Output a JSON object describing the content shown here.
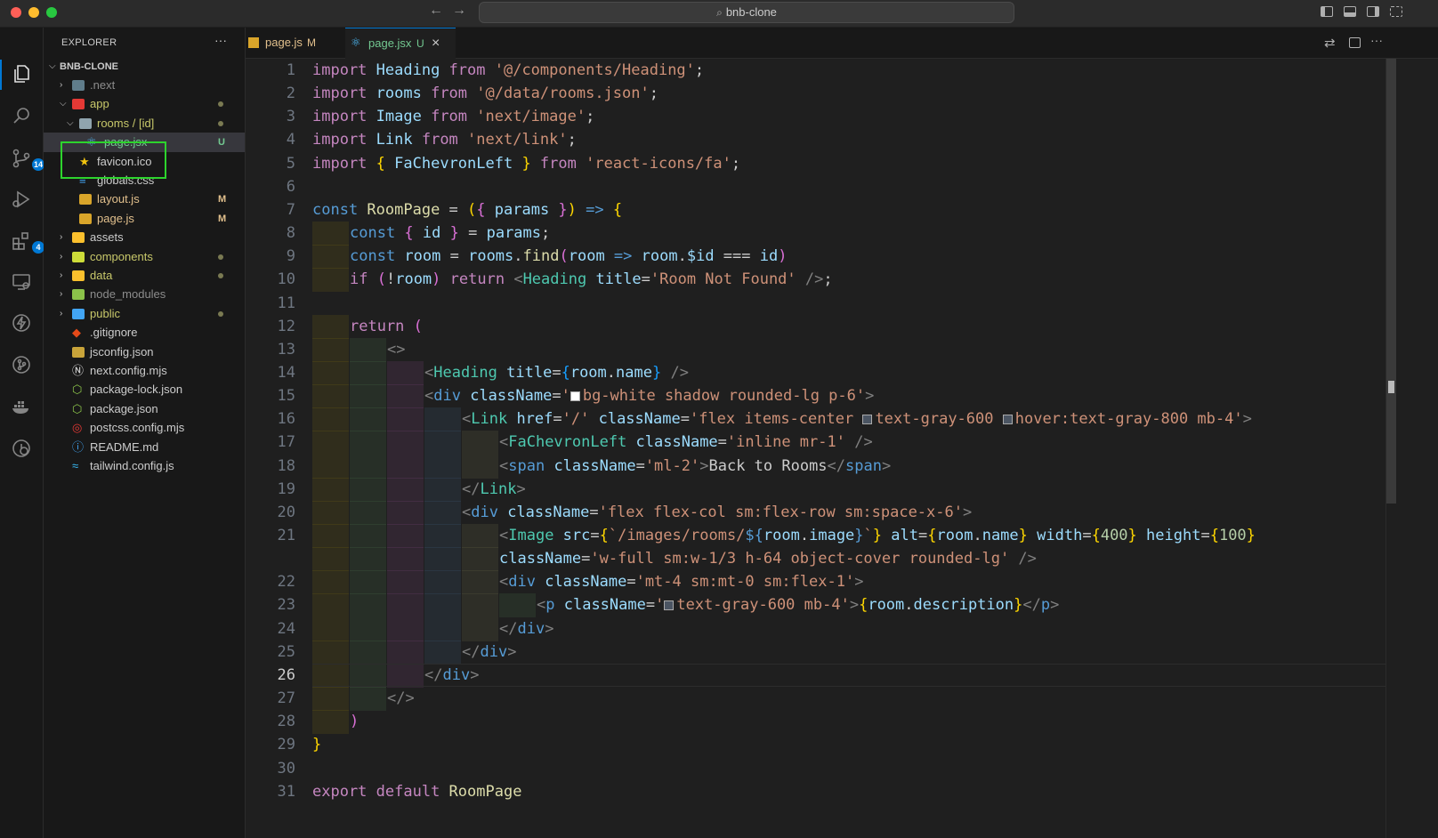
{
  "window": {
    "title": "bnb-clone",
    "back": "←",
    "forward": "→"
  },
  "explorer": {
    "title": "EXPLORER",
    "more": "···",
    "root": "BNB-CLONE",
    "items": [
      {
        "name": ".next",
        "kind": "folder",
        "depth": 1,
        "expanded": false,
        "status": ""
      },
      {
        "name": "app",
        "kind": "folder",
        "depth": 1,
        "expanded": true,
        "status": "dot"
      },
      {
        "name": "rooms / [id]",
        "kind": "folder",
        "depth": 2,
        "expanded": true,
        "status": "dot"
      },
      {
        "name": "page.jsx",
        "kind": "react",
        "depth": 3,
        "status": "U"
      },
      {
        "name": "favicon.ico",
        "kind": "star",
        "depth": 2,
        "status": ""
      },
      {
        "name": "globals.css",
        "kind": "css",
        "depth": 2,
        "status": ""
      },
      {
        "name": "layout.js",
        "kind": "js",
        "depth": 2,
        "status": "M"
      },
      {
        "name": "page.js",
        "kind": "js",
        "depth": 2,
        "status": "M"
      },
      {
        "name": "assets",
        "kind": "folder",
        "depth": 1,
        "expanded": false,
        "status": ""
      },
      {
        "name": "components",
        "kind": "folder",
        "depth": 1,
        "expanded": false,
        "status": "dot"
      },
      {
        "name": "data",
        "kind": "folder",
        "depth": 1,
        "expanded": false,
        "status": "dot"
      },
      {
        "name": "node_modules",
        "kind": "folder",
        "depth": 1,
        "expanded": false,
        "status": ""
      },
      {
        "name": "public",
        "kind": "folder",
        "depth": 1,
        "expanded": false,
        "status": "dot"
      },
      {
        "name": ".gitignore",
        "kind": "git",
        "depth": 1,
        "status": ""
      },
      {
        "name": "jsconfig.json",
        "kind": "json",
        "depth": 1,
        "status": ""
      },
      {
        "name": "next.config.mjs",
        "kind": "next",
        "depth": 1,
        "status": ""
      },
      {
        "name": "package-lock.json",
        "kind": "npm",
        "depth": 1,
        "status": ""
      },
      {
        "name": "package.json",
        "kind": "npm",
        "depth": 1,
        "status": ""
      },
      {
        "name": "postcss.config.mjs",
        "kind": "postcss",
        "depth": 1,
        "status": ""
      },
      {
        "name": "README.md",
        "kind": "info",
        "depth": 1,
        "status": ""
      },
      {
        "name": "tailwind.config.js",
        "kind": "tailwind",
        "depth": 1,
        "status": ""
      }
    ]
  },
  "activity_bar": {
    "source_control_badge": "14",
    "extensions_badge": "4"
  },
  "tabs": [
    {
      "label": "page.js",
      "status": "M",
      "active": false
    },
    {
      "label": "page.jsx",
      "status": "U",
      "active": true,
      "close": "×"
    }
  ],
  "editor": {
    "current_line": 26,
    "lines": [
      {
        "n": "1",
        "indent": 0,
        "t": [
          [
            "kw",
            "import "
          ],
          [
            "id",
            "Heading "
          ],
          [
            "kw",
            "from "
          ],
          [
            "str",
            "'@/components/Heading'"
          ],
          [
            "pl",
            ";"
          ]
        ]
      },
      {
        "n": "2",
        "indent": 0,
        "t": [
          [
            "kw",
            "import "
          ],
          [
            "id",
            "rooms "
          ],
          [
            "kw",
            "from "
          ],
          [
            "str",
            "'@/data/rooms.json'"
          ],
          [
            "pl",
            ";"
          ]
        ]
      },
      {
        "n": "3",
        "indent": 0,
        "t": [
          [
            "kw",
            "import "
          ],
          [
            "id",
            "Image "
          ],
          [
            "kw",
            "from "
          ],
          [
            "str",
            "'next/image'"
          ],
          [
            "pl",
            ";"
          ]
        ]
      },
      {
        "n": "4",
        "indent": 0,
        "t": [
          [
            "kw",
            "import "
          ],
          [
            "id",
            "Link "
          ],
          [
            "kw",
            "from "
          ],
          [
            "str",
            "'next/link'"
          ],
          [
            "pl",
            ";"
          ]
        ]
      },
      {
        "n": "5",
        "indent": 0,
        "t": [
          [
            "kw",
            "import "
          ],
          [
            "b1",
            "{ "
          ],
          [
            "id",
            "FaChevronLeft "
          ],
          [
            "b1",
            "} "
          ],
          [
            "kw",
            "from "
          ],
          [
            "str",
            "'react-icons/fa'"
          ],
          [
            "pl",
            ";"
          ]
        ]
      },
      {
        "n": "6",
        "indent": 0,
        "t": []
      },
      {
        "n": "7",
        "indent": 0,
        "t": [
          [
            "kb",
            "const "
          ],
          [
            "fn",
            "RoomPage "
          ],
          [
            "pl",
            "= "
          ],
          [
            "b1",
            "("
          ],
          [
            "b2",
            "{ "
          ],
          [
            "id",
            "params "
          ],
          [
            "b2",
            "}"
          ],
          [
            "b1",
            ")"
          ],
          [
            "kb",
            " => "
          ],
          [
            "b1",
            "{"
          ]
        ]
      },
      {
        "n": "8",
        "indent": 1,
        "t": [
          [
            "kb",
            "const "
          ],
          [
            "b2",
            "{ "
          ],
          [
            "id",
            "id "
          ],
          [
            "b2",
            "} "
          ],
          [
            "pl",
            "= "
          ],
          [
            "id",
            "params"
          ],
          [
            "pl",
            ";"
          ]
        ]
      },
      {
        "n": "9",
        "indent": 1,
        "t": [
          [
            "kb",
            "const "
          ],
          [
            "id",
            "room "
          ],
          [
            "pl",
            "= "
          ],
          [
            "id",
            "rooms"
          ],
          [
            "pl",
            "."
          ],
          [
            "fn",
            "find"
          ],
          [
            "b2",
            "("
          ],
          [
            "id",
            "room "
          ],
          [
            "kb",
            "=> "
          ],
          [
            "id",
            "room"
          ],
          [
            "pl",
            "."
          ],
          [
            "id",
            "$id "
          ],
          [
            "pl",
            "=== "
          ],
          [
            "id",
            "id"
          ],
          [
            "b2",
            ")"
          ]
        ]
      },
      {
        "n": "10",
        "indent": 1,
        "t": [
          [
            "kw",
            "if "
          ],
          [
            "b2",
            "("
          ],
          [
            "pl",
            "!"
          ],
          [
            "id",
            "room"
          ],
          [
            "b2",
            ") "
          ],
          [
            "kw",
            "return "
          ],
          [
            "ang",
            "<"
          ],
          [
            "tag",
            "Heading "
          ],
          [
            "attr",
            "title"
          ],
          [
            "pl",
            "="
          ],
          [
            "str",
            "'Room Not Found' "
          ],
          [
            "ang",
            "/>"
          ],
          [
            "pl",
            ";"
          ]
        ]
      },
      {
        "n": "11",
        "indent": 0,
        "t": []
      },
      {
        "n": "12",
        "indent": 1,
        "t": [
          [
            "kw",
            "return "
          ],
          [
            "b2",
            "("
          ]
        ]
      },
      {
        "n": "13",
        "indent": 2,
        "t": [
          [
            "ang",
            "<>"
          ]
        ]
      },
      {
        "n": "14",
        "indent": 3,
        "t": [
          [
            "ang",
            "<"
          ],
          [
            "tag",
            "Heading "
          ],
          [
            "attr",
            "title"
          ],
          [
            "pl",
            "="
          ],
          [
            "b3",
            "{"
          ],
          [
            "id",
            "room"
          ],
          [
            "pl",
            "."
          ],
          [
            "id",
            "name"
          ],
          [
            "b3",
            "} "
          ],
          [
            "ang",
            "/>"
          ]
        ]
      },
      {
        "n": "15",
        "indent": 3,
        "t": [
          [
            "ang",
            "<"
          ],
          [
            "kb",
            "div "
          ],
          [
            "attr",
            "className"
          ],
          [
            "pl",
            "="
          ],
          [
            "str",
            "'"
          ],
          [
            "swW",
            ""
          ],
          [
            "str",
            "bg-white shadow rounded-lg p-6'"
          ],
          [
            "ang",
            ">"
          ]
        ]
      },
      {
        "n": "16",
        "indent": 4,
        "t": [
          [
            "ang",
            "<"
          ],
          [
            "tag",
            "Link "
          ],
          [
            "attr",
            "href"
          ],
          [
            "pl",
            "="
          ],
          [
            "str",
            "'/' "
          ],
          [
            "attr",
            "className"
          ],
          [
            "pl",
            "="
          ],
          [
            "str",
            "'flex items-center "
          ],
          [
            "swG",
            ""
          ],
          [
            "str",
            "text-gray-600 "
          ],
          [
            "swG",
            ""
          ],
          [
            "str",
            "hover:text-gray-800 mb-4'"
          ],
          [
            "ang",
            ">"
          ]
        ]
      },
      {
        "n": "17",
        "indent": 5,
        "t": [
          [
            "ang",
            "<"
          ],
          [
            "tag",
            "FaChevronLeft "
          ],
          [
            "attr",
            "className"
          ],
          [
            "pl",
            "="
          ],
          [
            "str",
            "'inline mr-1' "
          ],
          [
            "ang",
            "/>"
          ]
        ]
      },
      {
        "n": "18",
        "indent": 5,
        "t": [
          [
            "ang",
            "<"
          ],
          [
            "kb",
            "span "
          ],
          [
            "attr",
            "className"
          ],
          [
            "pl",
            "="
          ],
          [
            "str",
            "'ml-2'"
          ],
          [
            "ang",
            ">"
          ],
          [
            "pl",
            "Back to Rooms"
          ],
          [
            "ang",
            "</"
          ],
          [
            "kb",
            "span"
          ],
          [
            "ang",
            ">"
          ]
        ]
      },
      {
        "n": "19",
        "indent": 4,
        "t": [
          [
            "ang",
            "</"
          ],
          [
            "tag",
            "Link"
          ],
          [
            "ang",
            ">"
          ]
        ]
      },
      {
        "n": "20",
        "indent": 4,
        "t": [
          [
            "ang",
            "<"
          ],
          [
            "kb",
            "div "
          ],
          [
            "attr",
            "className"
          ],
          [
            "pl",
            "="
          ],
          [
            "str",
            "'flex flex-col sm:flex-row sm:space-x-6'"
          ],
          [
            "ang",
            ">"
          ]
        ]
      },
      {
        "n": "21",
        "indent": 5,
        "t": [
          [
            "ang",
            "<"
          ],
          [
            "tag",
            "Image "
          ],
          [
            "attr",
            "src"
          ],
          [
            "pl",
            "="
          ],
          [
            "b1",
            "{"
          ],
          [
            "str",
            "`/images/rooms/"
          ],
          [
            "kb",
            "${"
          ],
          [
            "id",
            "room"
          ],
          [
            "pl",
            "."
          ],
          [
            "id",
            "image"
          ],
          [
            "kb",
            "}"
          ],
          [
            "str",
            "`"
          ],
          [
            "b1",
            "} "
          ],
          [
            "attr",
            "alt"
          ],
          [
            "pl",
            "="
          ],
          [
            "b1",
            "{"
          ],
          [
            "id",
            "room"
          ],
          [
            "pl",
            "."
          ],
          [
            "id",
            "name"
          ],
          [
            "b1",
            "} "
          ],
          [
            "attr",
            "width"
          ],
          [
            "pl",
            "="
          ],
          [
            "b1",
            "{"
          ],
          [
            "num",
            "400"
          ],
          [
            "b1",
            "} "
          ],
          [
            "attr",
            "height"
          ],
          [
            "pl",
            "="
          ],
          [
            "b1",
            "{"
          ],
          [
            "num",
            "100"
          ],
          [
            "b1",
            "}"
          ]
        ]
      },
      {
        "n": "",
        "indent": 5,
        "t": [
          [
            "attr",
            "className"
          ],
          [
            "pl",
            "="
          ],
          [
            "str",
            "'w-full sm:w-1/3 h-64 object-cover rounded-lg' "
          ],
          [
            "ang",
            "/>"
          ]
        ]
      },
      {
        "n": "22",
        "indent": 5,
        "t": [
          [
            "ang",
            "<"
          ],
          [
            "kb",
            "div "
          ],
          [
            "attr",
            "className"
          ],
          [
            "pl",
            "="
          ],
          [
            "str",
            "'mt-4 sm:mt-0 sm:flex-1'"
          ],
          [
            "ang",
            ">"
          ]
        ]
      },
      {
        "n": "23",
        "indent": 6,
        "t": [
          [
            "ang",
            "<"
          ],
          [
            "kb",
            "p "
          ],
          [
            "attr",
            "className"
          ],
          [
            "pl",
            "="
          ],
          [
            "str",
            "'"
          ],
          [
            "swG",
            ""
          ],
          [
            "str",
            "text-gray-600 mb-4'"
          ],
          [
            "ang",
            ">"
          ],
          [
            "b1",
            "{"
          ],
          [
            "id",
            "room"
          ],
          [
            "pl",
            "."
          ],
          [
            "id",
            "description"
          ],
          [
            "b1",
            "}"
          ],
          [
            "ang",
            "</"
          ],
          [
            "kb",
            "p"
          ],
          [
            "ang",
            ">"
          ]
        ]
      },
      {
        "n": "24",
        "indent": 5,
        "t": [
          [
            "ang",
            "</"
          ],
          [
            "kb",
            "div"
          ],
          [
            "ang",
            ">"
          ]
        ]
      },
      {
        "n": "25",
        "indent": 4,
        "t": [
          [
            "ang",
            "</"
          ],
          [
            "kb",
            "div"
          ],
          [
            "ang",
            ">"
          ]
        ]
      },
      {
        "n": "26",
        "indent": 3,
        "t": [
          [
            "ang",
            "</"
          ],
          [
            "kb",
            "div"
          ],
          [
            "ang",
            ">"
          ]
        ]
      },
      {
        "n": "27",
        "indent": 2,
        "t": [
          [
            "ang",
            "</>"
          ]
        ]
      },
      {
        "n": "28",
        "indent": 1,
        "t": [
          [
            "b2",
            ")"
          ]
        ]
      },
      {
        "n": "29",
        "indent": 0,
        "t": [
          [
            "b1",
            "}"
          ]
        ]
      },
      {
        "n": "30",
        "indent": 0,
        "t": []
      },
      {
        "n": "31",
        "indent": 0,
        "t": [
          [
            "kw",
            "export "
          ],
          [
            "kw",
            "default "
          ],
          [
            "fn",
            "RoomPage"
          ]
        ]
      }
    ]
  },
  "colors": {
    "accent": "#0078d4",
    "highlight_box": "#2dd42d",
    "modified": "#e2c08d",
    "untracked": "#73c991"
  }
}
